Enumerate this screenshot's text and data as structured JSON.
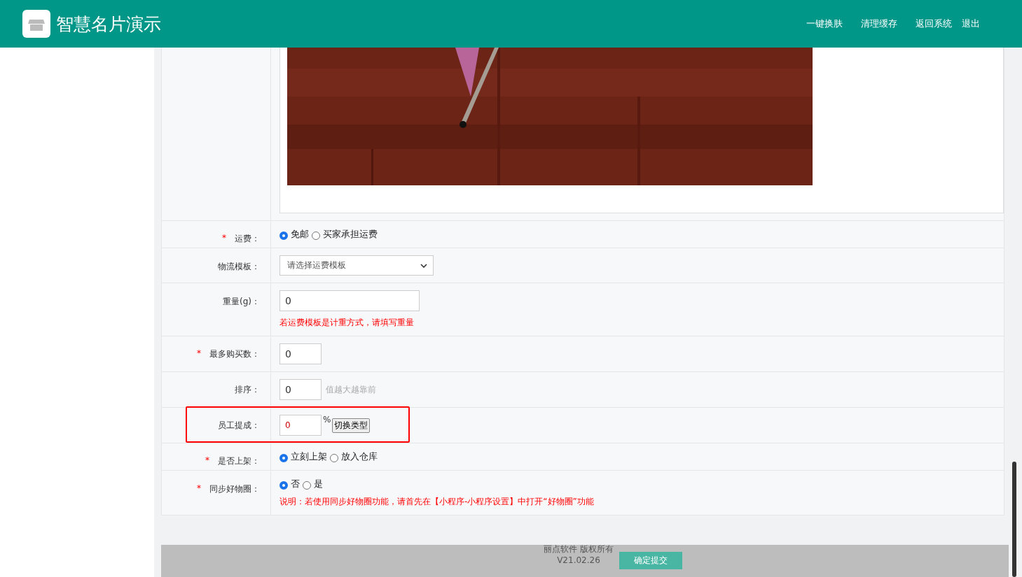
{
  "header": {
    "title": "智慧名片演示",
    "links": [
      "一键换肤",
      "清理缓存",
      "返回系统",
      "退出"
    ]
  },
  "rows": [
    {
      "kind": "radio",
      "label": "运费：",
      "mark": "*",
      "options": [
        {
          "label": "免邮",
          "selected": true
        },
        {
          "label": "买家承担运费",
          "selected": false
        }
      ]
    },
    {
      "kind": "select",
      "label": "物流模板：",
      "value": "请选择运费模板"
    },
    {
      "kind": "input",
      "label": "重量(g)：",
      "value": "0",
      "wide": true,
      "note": "若运费模板是计重方式，请填写重量"
    },
    {
      "kind": "input",
      "label": "最多购买数：",
      "mark": "*",
      "value": "0",
      "wide": false
    },
    {
      "kind": "input",
      "label": "排序：",
      "value": "0",
      "wide": false,
      "hint": "值越大越靠前"
    },
    {
      "kind": "commission",
      "label": "员工提成：",
      "value": "0",
      "unit": "%",
      "button": "切换类型",
      "highlighted": true
    },
    {
      "kind": "radio",
      "label": "是否上架：",
      "mark": "*",
      "options": [
        {
          "label": "立刻上架",
          "selected": true
        },
        {
          "label": "放入仓库",
          "selected": false
        }
      ]
    },
    {
      "kind": "radio",
      "label": "同步好物圈：",
      "mark": "*",
      "options": [
        {
          "label": "否",
          "selected": true
        },
        {
          "label": "是",
          "selected": false
        }
      ],
      "note": "说明：若使用同步好物圈功能，请首先在【小程序-小程序设置】中打开“好物圈”功能"
    }
  ],
  "footer": {
    "copyright": "丽点软件 版权所有",
    "version": "V21.02.26",
    "submit": "确定提交"
  }
}
